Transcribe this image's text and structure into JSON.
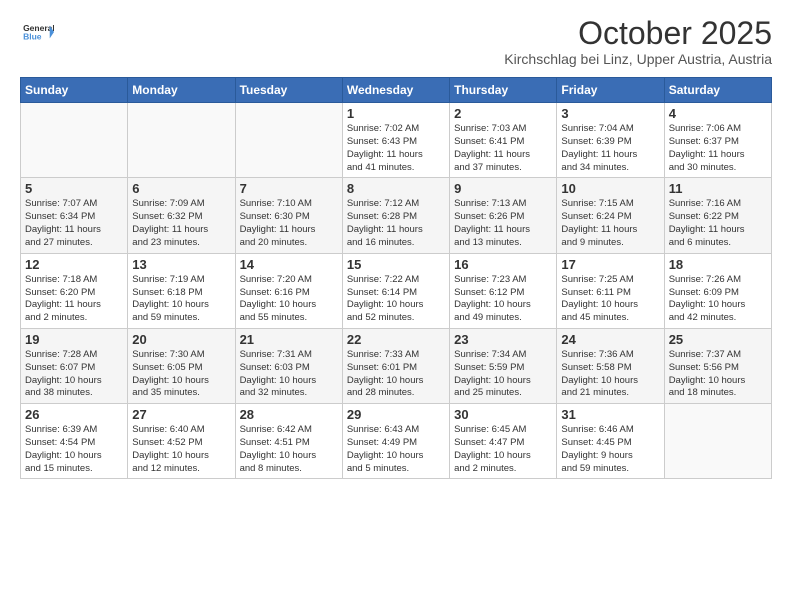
{
  "header": {
    "logo_line1": "General",
    "logo_line2": "Blue",
    "month": "October 2025",
    "location": "Kirchschlag bei Linz, Upper Austria, Austria"
  },
  "weekdays": [
    "Sunday",
    "Monday",
    "Tuesday",
    "Wednesday",
    "Thursday",
    "Friday",
    "Saturday"
  ],
  "weeks": [
    [
      {
        "day": "",
        "info": ""
      },
      {
        "day": "",
        "info": ""
      },
      {
        "day": "",
        "info": ""
      },
      {
        "day": "1",
        "info": "Sunrise: 7:02 AM\nSunset: 6:43 PM\nDaylight: 11 hours\nand 41 minutes."
      },
      {
        "day": "2",
        "info": "Sunrise: 7:03 AM\nSunset: 6:41 PM\nDaylight: 11 hours\nand 37 minutes."
      },
      {
        "day": "3",
        "info": "Sunrise: 7:04 AM\nSunset: 6:39 PM\nDaylight: 11 hours\nand 34 minutes."
      },
      {
        "day": "4",
        "info": "Sunrise: 7:06 AM\nSunset: 6:37 PM\nDaylight: 11 hours\nand 30 minutes."
      }
    ],
    [
      {
        "day": "5",
        "info": "Sunrise: 7:07 AM\nSunset: 6:34 PM\nDaylight: 11 hours\nand 27 minutes."
      },
      {
        "day": "6",
        "info": "Sunrise: 7:09 AM\nSunset: 6:32 PM\nDaylight: 11 hours\nand 23 minutes."
      },
      {
        "day": "7",
        "info": "Sunrise: 7:10 AM\nSunset: 6:30 PM\nDaylight: 11 hours\nand 20 minutes."
      },
      {
        "day": "8",
        "info": "Sunrise: 7:12 AM\nSunset: 6:28 PM\nDaylight: 11 hours\nand 16 minutes."
      },
      {
        "day": "9",
        "info": "Sunrise: 7:13 AM\nSunset: 6:26 PM\nDaylight: 11 hours\nand 13 minutes."
      },
      {
        "day": "10",
        "info": "Sunrise: 7:15 AM\nSunset: 6:24 PM\nDaylight: 11 hours\nand 9 minutes."
      },
      {
        "day": "11",
        "info": "Sunrise: 7:16 AM\nSunset: 6:22 PM\nDaylight: 11 hours\nand 6 minutes."
      }
    ],
    [
      {
        "day": "12",
        "info": "Sunrise: 7:18 AM\nSunset: 6:20 PM\nDaylight: 11 hours\nand 2 minutes."
      },
      {
        "day": "13",
        "info": "Sunrise: 7:19 AM\nSunset: 6:18 PM\nDaylight: 10 hours\nand 59 minutes."
      },
      {
        "day": "14",
        "info": "Sunrise: 7:20 AM\nSunset: 6:16 PM\nDaylight: 10 hours\nand 55 minutes."
      },
      {
        "day": "15",
        "info": "Sunrise: 7:22 AM\nSunset: 6:14 PM\nDaylight: 10 hours\nand 52 minutes."
      },
      {
        "day": "16",
        "info": "Sunrise: 7:23 AM\nSunset: 6:12 PM\nDaylight: 10 hours\nand 49 minutes."
      },
      {
        "day": "17",
        "info": "Sunrise: 7:25 AM\nSunset: 6:11 PM\nDaylight: 10 hours\nand 45 minutes."
      },
      {
        "day": "18",
        "info": "Sunrise: 7:26 AM\nSunset: 6:09 PM\nDaylight: 10 hours\nand 42 minutes."
      }
    ],
    [
      {
        "day": "19",
        "info": "Sunrise: 7:28 AM\nSunset: 6:07 PM\nDaylight: 10 hours\nand 38 minutes."
      },
      {
        "day": "20",
        "info": "Sunrise: 7:30 AM\nSunset: 6:05 PM\nDaylight: 10 hours\nand 35 minutes."
      },
      {
        "day": "21",
        "info": "Sunrise: 7:31 AM\nSunset: 6:03 PM\nDaylight: 10 hours\nand 32 minutes."
      },
      {
        "day": "22",
        "info": "Sunrise: 7:33 AM\nSunset: 6:01 PM\nDaylight: 10 hours\nand 28 minutes."
      },
      {
        "day": "23",
        "info": "Sunrise: 7:34 AM\nSunset: 5:59 PM\nDaylight: 10 hours\nand 25 minutes."
      },
      {
        "day": "24",
        "info": "Sunrise: 7:36 AM\nSunset: 5:58 PM\nDaylight: 10 hours\nand 21 minutes."
      },
      {
        "day": "25",
        "info": "Sunrise: 7:37 AM\nSunset: 5:56 PM\nDaylight: 10 hours\nand 18 minutes."
      }
    ],
    [
      {
        "day": "26",
        "info": "Sunrise: 6:39 AM\nSunset: 4:54 PM\nDaylight: 10 hours\nand 15 minutes."
      },
      {
        "day": "27",
        "info": "Sunrise: 6:40 AM\nSunset: 4:52 PM\nDaylight: 10 hours\nand 12 minutes."
      },
      {
        "day": "28",
        "info": "Sunrise: 6:42 AM\nSunset: 4:51 PM\nDaylight: 10 hours\nand 8 minutes."
      },
      {
        "day": "29",
        "info": "Sunrise: 6:43 AM\nSunset: 4:49 PM\nDaylight: 10 hours\nand 5 minutes."
      },
      {
        "day": "30",
        "info": "Sunrise: 6:45 AM\nSunset: 4:47 PM\nDaylight: 10 hours\nand 2 minutes."
      },
      {
        "day": "31",
        "info": "Sunrise: 6:46 AM\nSunset: 4:45 PM\nDaylight: 9 hours\nand 59 minutes."
      },
      {
        "day": "",
        "info": ""
      }
    ]
  ]
}
